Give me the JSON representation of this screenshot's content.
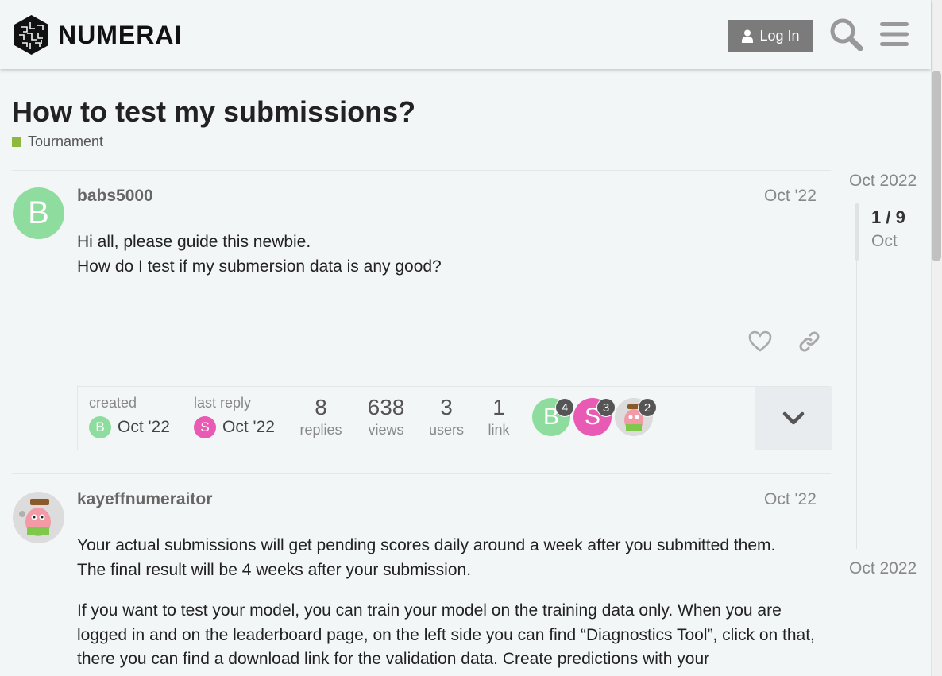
{
  "header": {
    "brand": "NUMERAI",
    "login_label": "Log In",
    "search_icon": "search-icon",
    "menu_icon": "hamburger-icon"
  },
  "topic": {
    "title": "How to test my submissions?",
    "category": "Tournament",
    "category_color": "#8fb83e"
  },
  "posts": [
    {
      "username": "babs5000",
      "avatar_letter": "B",
      "avatar_color": "#8fdd9e",
      "date": "Oct '22",
      "paragraphs": [
        "Hi all, please guide this newbie.",
        "How do I test if my submersion data is any good?"
      ]
    },
    {
      "username": "kayeffnumeraitor",
      "date": "Oct '22",
      "paragraphs": [
        "Your actual submissions will get pending scores daily around a week after you submitted them.",
        "The final result will be 4 weeks after your submission.",
        "If you want to test your model, you can train your model on the training data only. When you are logged in and on the leaderboard page, on the left side you can find “Diagnostics Tool”, click on that, there you can find a download link for the validation data. Create predictions with your"
      ]
    }
  ],
  "topic_map": {
    "created_label": "created",
    "created_date": "Oct '22",
    "created_avatar_letter": "B",
    "last_reply_label": "last reply",
    "last_reply_date": "Oct '22",
    "last_reply_avatar_letter": "S",
    "stats": [
      {
        "value": "8",
        "label": "replies"
      },
      {
        "value": "638",
        "label": "views"
      },
      {
        "value": "3",
        "label": "users"
      },
      {
        "value": "1",
        "label": "link"
      }
    ],
    "participants": [
      {
        "letter": "B",
        "count": "4",
        "color": "#8fdd9e"
      },
      {
        "letter": "S",
        "count": "3",
        "color": "#e85ab3"
      },
      {
        "letter": "",
        "count": "2",
        "color": "#dddddd"
      }
    ]
  },
  "timeline": {
    "start_label": "Oct 2022",
    "position": "1 / 9",
    "current_date": "Oct",
    "end_label": "Oct 2022"
  }
}
